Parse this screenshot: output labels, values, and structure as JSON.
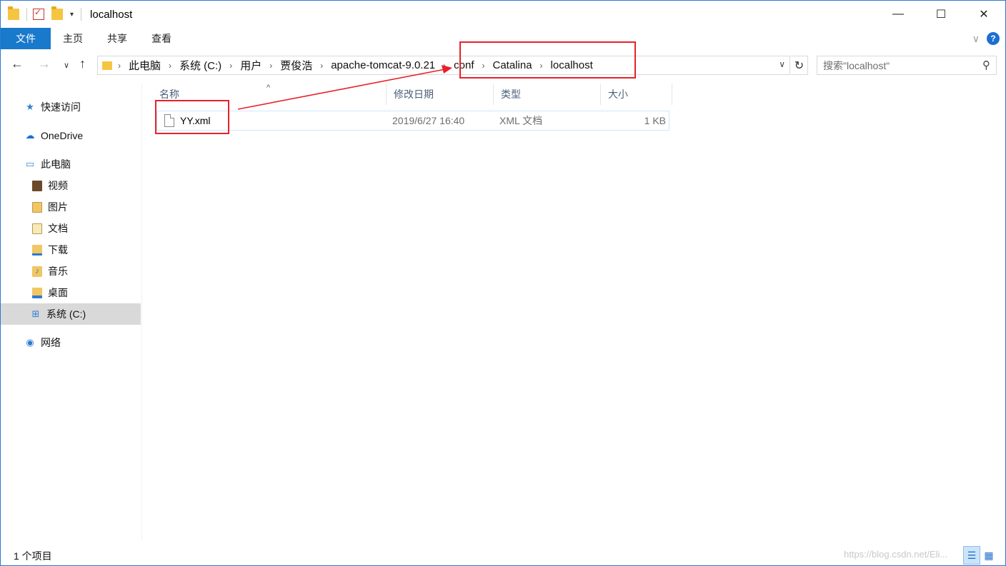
{
  "window": {
    "title": "localhost",
    "controls": {
      "minimize": "—",
      "maximize": "☐",
      "close": "✕"
    }
  },
  "ribbon": {
    "tabs": [
      "文件",
      "主页",
      "共享",
      "查看"
    ]
  },
  "nav": {
    "breadcrumb": [
      "此电脑",
      "系统 (C:)",
      "用户",
      "贾俊浩",
      "apache-tomcat-9.0.21",
      "conf",
      "Catalina",
      "localhost"
    ],
    "search_placeholder": "搜索\"localhost\""
  },
  "sidebar": {
    "items": [
      {
        "label": "快速访问",
        "icon": "star-icon"
      },
      {
        "label": "OneDrive",
        "icon": "cloud-icon"
      },
      {
        "label": "此电脑",
        "icon": "computer-icon"
      },
      {
        "label": "视频",
        "icon": "video-library-icon"
      },
      {
        "label": "图片",
        "icon": "pictures-library-icon"
      },
      {
        "label": "文档",
        "icon": "documents-library-icon"
      },
      {
        "label": "下载",
        "icon": "downloads-library-icon"
      },
      {
        "label": "音乐",
        "icon": "music-library-icon"
      },
      {
        "label": "桌面",
        "icon": "desktop-library-icon"
      },
      {
        "label": "系统 (C:)",
        "icon": "drive-icon",
        "selected": true
      },
      {
        "label": "网络",
        "icon": "network-icon"
      }
    ]
  },
  "filelist": {
    "columns": [
      "名称",
      "修改日期",
      "类型",
      "大小"
    ],
    "rows": [
      {
        "name": "YY.xml",
        "modified": "2019/6/27 16:40",
        "type": "XML 文档",
        "size": "1 KB"
      }
    ]
  },
  "status": {
    "item_count": "1 个项目",
    "watermark": "https://blog.csdn.net/Eli..."
  },
  "colors": {
    "file_tab": "#1979ca",
    "annotation_red": "#e8202a",
    "selected_bg": "#d9d9d9"
  }
}
